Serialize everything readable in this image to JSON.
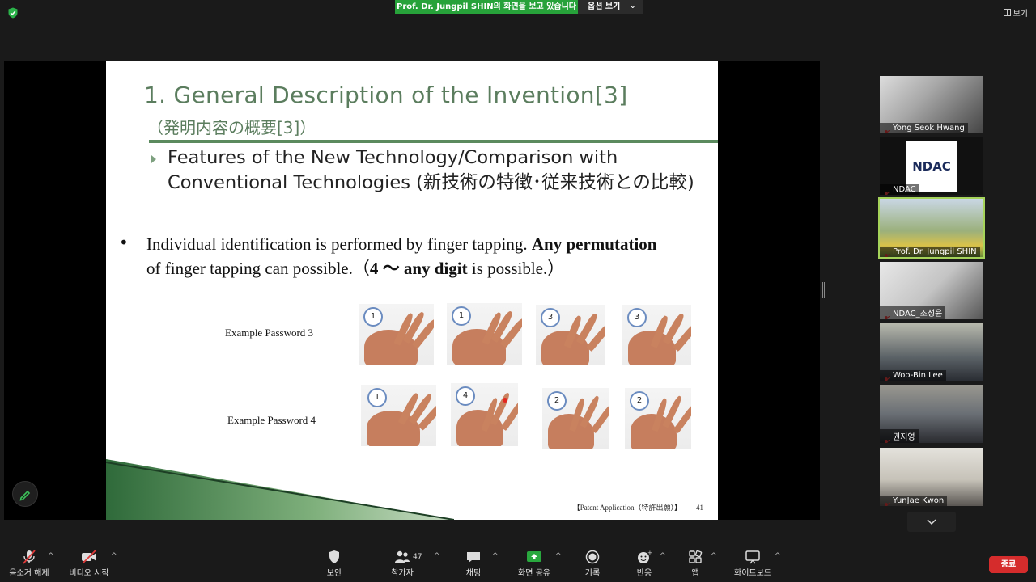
{
  "top_bar": {
    "share_banner": "Prof. Dr. Jungpil SHIN의 화면을 보고 있습니다",
    "view_options": "옵션 보기",
    "view": "보기"
  },
  "slide": {
    "title": "1. General Description of the Invention[3]",
    "subtitle": "（発明内容の概要[3]）",
    "bullet1": "Features of the New Technology/Comparison with Conventional Technologies (新技術の特徴･従来技術との比較)",
    "bullet2_parts": {
      "a": "Individual identification is performed by finger tapping. ",
      "b": "Any permutation",
      "c": " of finger tapping can possible.（",
      "d": "4 〜 any digit",
      "e": " is possible.）"
    },
    "example3_label": "Example Password 3",
    "example4_label": "Example Password 4",
    "example3_digits": [
      "1",
      "1",
      "3",
      "3"
    ],
    "example4_digits": [
      "1",
      "4",
      "2",
      "2"
    ],
    "footer": "【Patent Application（特許出願）】",
    "page_number": "41"
  },
  "participants": [
    {
      "name": "Yong Seok Hwang"
    },
    {
      "name": "NDAC",
      "logo": "NDAC"
    },
    {
      "name": "Prof. Dr. Jungpil SHIN"
    },
    {
      "name": "NDAC_조성윤"
    },
    {
      "name": "Woo-Bin Lee"
    },
    {
      "name": "권지영"
    },
    {
      "name": "YunJae Kwon"
    }
  ],
  "toolbar": {
    "mute": "음소거 해제",
    "video": "비디오 시작",
    "security": "보안",
    "participants": "참가자",
    "participant_count": "47",
    "chat": "채팅",
    "share": "화면 공유",
    "record": "기록",
    "reactions": "반응",
    "apps": "앱",
    "whiteboard": "화이트보드",
    "end": "종료"
  },
  "colors": {
    "banner_green": "#27a23a",
    "end_red": "#d52c2c",
    "slide_green": "#5b7d5e",
    "active_outline": "#a5d35a"
  }
}
